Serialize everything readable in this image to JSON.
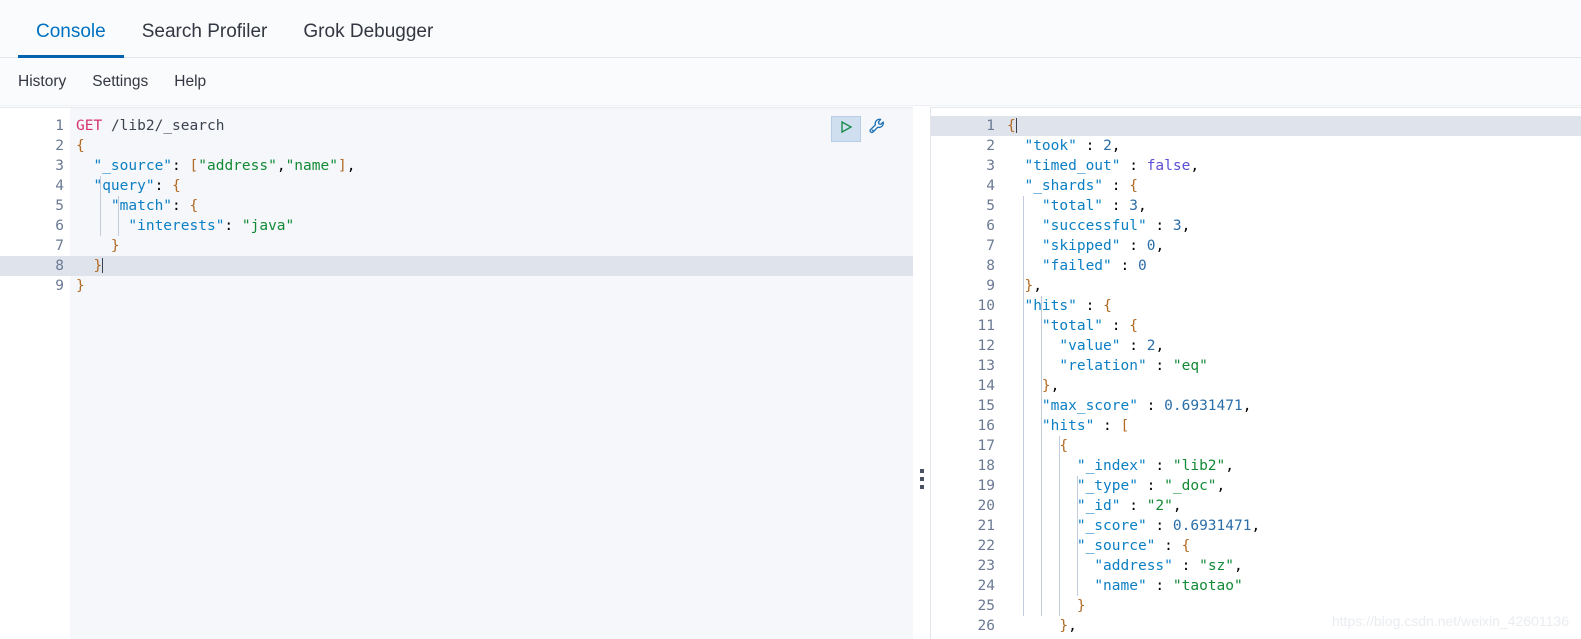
{
  "tabs": [
    {
      "label": "Console",
      "active": true
    },
    {
      "label": "Search Profiler",
      "active": false
    },
    {
      "label": "Grok Debugger",
      "active": false
    }
  ],
  "submenu": [
    {
      "label": "History"
    },
    {
      "label": "Settings"
    },
    {
      "label": "Help"
    }
  ],
  "toolbar": {
    "play_icon": "play-triangle-icon",
    "wrench_icon": "wrench-icon",
    "play_title": "Click to send request",
    "wrench_title": "Open documentation"
  },
  "request_editor": {
    "active_line": 8,
    "lines": [
      {
        "n": 1,
        "fold": "",
        "text": "GET /lib2/_search"
      },
      {
        "n": 2,
        "fold": "down",
        "text": "{"
      },
      {
        "n": 3,
        "fold": "",
        "text": "  \"_source\": [\"address\",\"name\"],"
      },
      {
        "n": 4,
        "fold": "down",
        "text": "  \"query\": {"
      },
      {
        "n": 5,
        "fold": "down",
        "text": "    \"match\": {"
      },
      {
        "n": 6,
        "fold": "",
        "text": "      \"interests\": \"java\""
      },
      {
        "n": 7,
        "fold": "up",
        "text": "    }"
      },
      {
        "n": 8,
        "fold": "up",
        "text": "  }"
      },
      {
        "n": 9,
        "fold": "up",
        "text": "}"
      }
    ]
  },
  "response_editor": {
    "active_line": 1,
    "lines": [
      {
        "n": 1,
        "fold": "down",
        "text": "{"
      },
      {
        "n": 2,
        "fold": "",
        "text": "  \"took\" : 2,"
      },
      {
        "n": 3,
        "fold": "",
        "text": "  \"timed_out\" : false,"
      },
      {
        "n": 4,
        "fold": "down",
        "text": "  \"_shards\" : {"
      },
      {
        "n": 5,
        "fold": "",
        "text": "    \"total\" : 3,"
      },
      {
        "n": 6,
        "fold": "",
        "text": "    \"successful\" : 3,"
      },
      {
        "n": 7,
        "fold": "",
        "text": "    \"skipped\" : 0,"
      },
      {
        "n": 8,
        "fold": "",
        "text": "    \"failed\" : 0"
      },
      {
        "n": 9,
        "fold": "up",
        "text": "  },"
      },
      {
        "n": 10,
        "fold": "down",
        "text": "  \"hits\" : {"
      },
      {
        "n": 11,
        "fold": "down",
        "text": "    \"total\" : {"
      },
      {
        "n": 12,
        "fold": "",
        "text": "      \"value\" : 2,"
      },
      {
        "n": 13,
        "fold": "",
        "text": "      \"relation\" : \"eq\""
      },
      {
        "n": 14,
        "fold": "up",
        "text": "    },"
      },
      {
        "n": 15,
        "fold": "",
        "text": "    \"max_score\" : 0.6931471,"
      },
      {
        "n": 16,
        "fold": "down",
        "text": "    \"hits\" : ["
      },
      {
        "n": 17,
        "fold": "down",
        "text": "      {"
      },
      {
        "n": 18,
        "fold": "",
        "text": "        \"_index\" : \"lib2\","
      },
      {
        "n": 19,
        "fold": "",
        "text": "        \"_type\" : \"_doc\","
      },
      {
        "n": 20,
        "fold": "",
        "text": "        \"_id\" : \"2\","
      },
      {
        "n": 21,
        "fold": "",
        "text": "        \"_score\" : 0.6931471,"
      },
      {
        "n": 22,
        "fold": "down",
        "text": "        \"_source\" : {"
      },
      {
        "n": 23,
        "fold": "",
        "text": "          \"address\" : \"sz\","
      },
      {
        "n": 24,
        "fold": "",
        "text": "          \"name\" : \"taotao\""
      },
      {
        "n": 25,
        "fold": "up",
        "text": "        }"
      },
      {
        "n": 26,
        "fold": "up",
        "text": "      },"
      }
    ]
  },
  "watermark": "https://blog.csdn.net/weixin_42601136",
  "colors": {
    "accent": "#0163ad",
    "active_tab_text": "#0071c2",
    "method": "#d6336c",
    "key": "#0b7fc4",
    "string": "#138a36",
    "number": "#2b6ea8",
    "boolean": "#5b4fd6",
    "editor_bg": "#f5f7fa",
    "active_line": "#dfe3ec"
  }
}
